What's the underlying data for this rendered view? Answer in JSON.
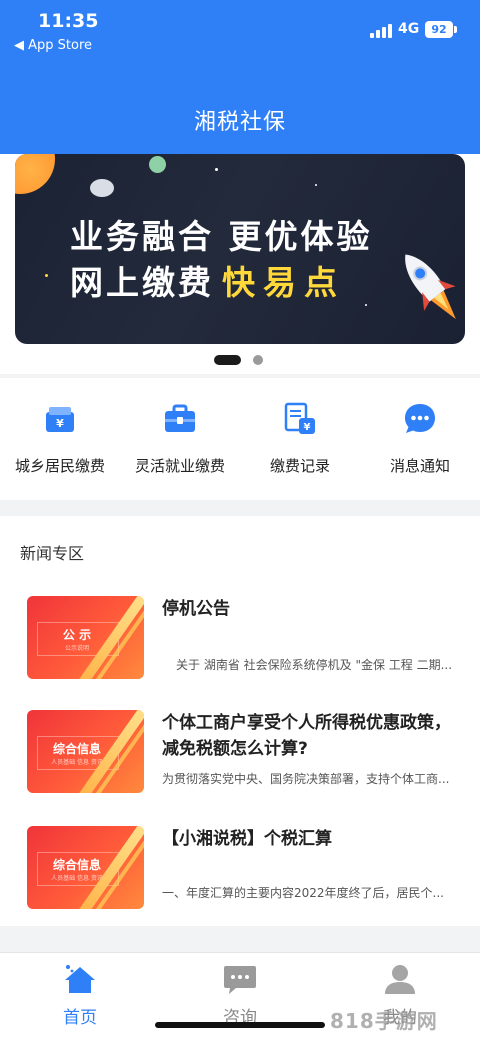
{
  "status_bar": {
    "time": "11:35",
    "back_label": "◀ App Store",
    "network": "4G",
    "battery": "92"
  },
  "header": {
    "title": "湘税社保"
  },
  "banner": {
    "line1": "业务融合 更优体验",
    "line2_prefix": "网上缴费",
    "line2_highlight": "快易点"
  },
  "carousel": {
    "active_index": 0,
    "count": 2
  },
  "quick_menu": [
    {
      "label": "城乡居民缴费",
      "icon": "wallet-yen-icon"
    },
    {
      "label": "灵活就业缴费",
      "icon": "briefcase-icon"
    },
    {
      "label": "缴费记录",
      "icon": "record-document-icon"
    },
    {
      "label": "消息通知",
      "icon": "chat-bubble-icon"
    }
  ],
  "news": {
    "section_title": "新闻专区",
    "items": [
      {
        "thumb_text": "公 示",
        "thumb_sub": "公示说明",
        "title": "停机公告",
        "desc": "关于 湖南省 社会保险系统停机及 \"金保 工程 二期..."
      },
      {
        "thumb_text": "综合信息",
        "thumb_sub": "人员基础  信息  资讯",
        "title": "个体工商户享受个人所得税优惠政策，减免税额怎么计算?",
        "desc": "为贯彻落实党中央、国务院决策部署，支持个体工商..."
      },
      {
        "thumb_text": "综合信息",
        "thumb_sub": "人员基础  信息  资讯",
        "title": "【小湘说税】个税汇算",
        "desc": "一、年度汇算的主要内容2022年度终了后，居民个..."
      }
    ]
  },
  "tabbar": {
    "tabs": [
      {
        "label": "首页",
        "icon": "home-icon",
        "active": true
      },
      {
        "label": "咨询",
        "icon": "chat-icon",
        "active": false
      },
      {
        "label": "我的",
        "icon": "user-icon",
        "active": false
      }
    ]
  },
  "watermark": "818手游网",
  "colors": {
    "primary": "#2f7ff7",
    "banner_bg": "#1f2637",
    "highlight": "#ffd83a",
    "news_thumb": "#f0343a"
  }
}
